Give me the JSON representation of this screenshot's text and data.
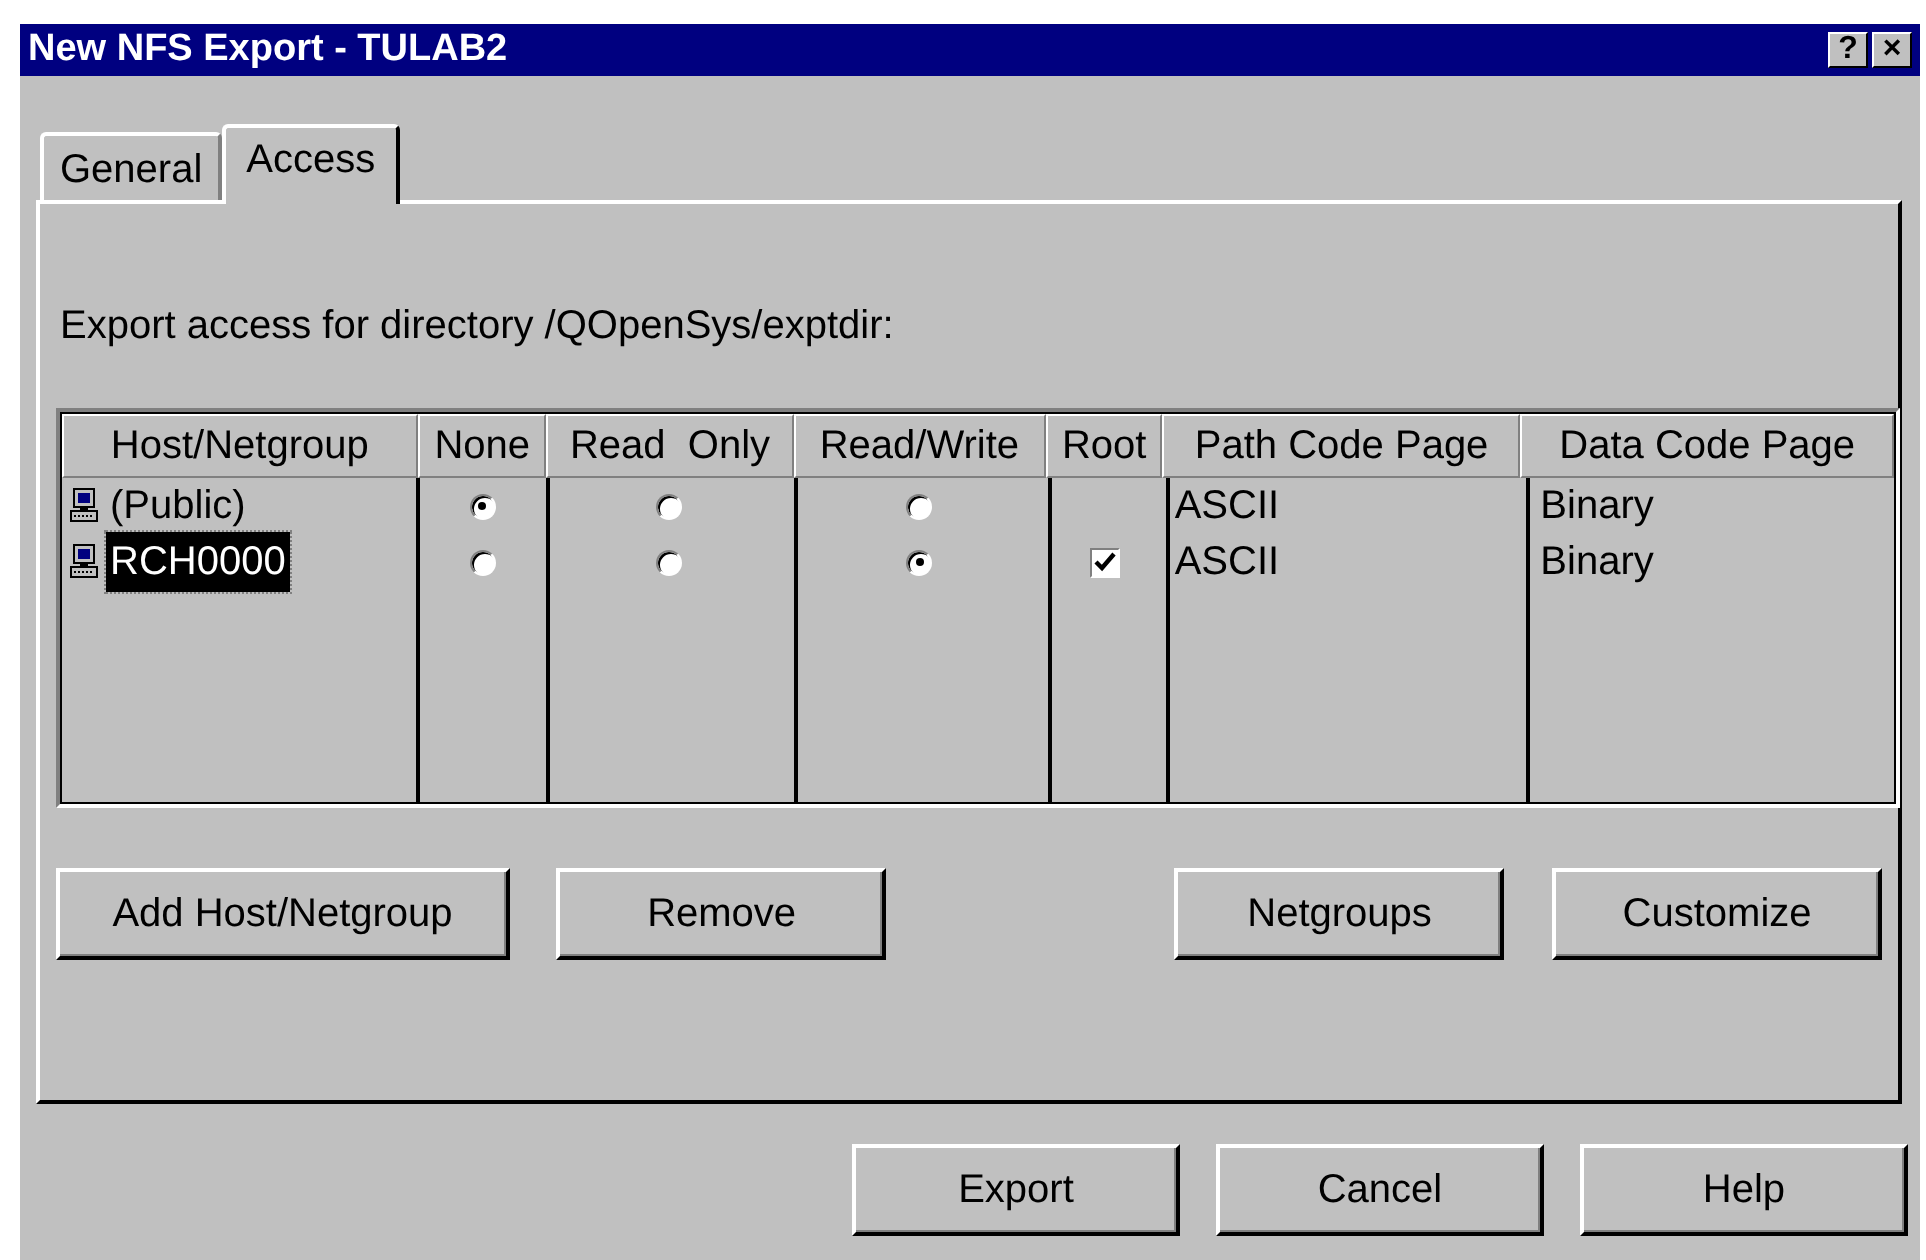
{
  "window": {
    "title": "New NFS Export - TULAB2",
    "title_buttons": [
      "?",
      "×"
    ]
  },
  "tabs": [
    {
      "label": "General",
      "selected": false
    },
    {
      "label": "Access",
      "selected": true
    }
  ],
  "description": "Export access for directory /QOpenSys/exptdir:",
  "table": {
    "columns": [
      "Host/Netgroup",
      "None",
      "Read  Only",
      "Read/Write",
      "Root",
      "Path Code Page",
      "Data Code Page"
    ],
    "rows": [
      {
        "host": "(Public)",
        "selected": false,
        "access": [
          {
            "selected": true
          },
          {
            "selected": false
          },
          {
            "selected": false
          }
        ],
        "path_code_page": "ASCII",
        "data_code_page": "Binary"
      },
      {
        "host": "RCH0000",
        "selected": true,
        "access": [
          {
            "selected": false
          },
          {
            "selected": false
          },
          {
            "selected": true
          }
        ],
        "root": {
          "checked": true
        },
        "path_code_page": "ASCII",
        "data_code_page": "Binary"
      }
    ]
  },
  "panel_buttons": [
    "Add Host/Netgroup",
    "Remove",
    "Netgroups",
    "Customize"
  ],
  "buttons": [
    "Export",
    "Cancel",
    "Help"
  ]
}
